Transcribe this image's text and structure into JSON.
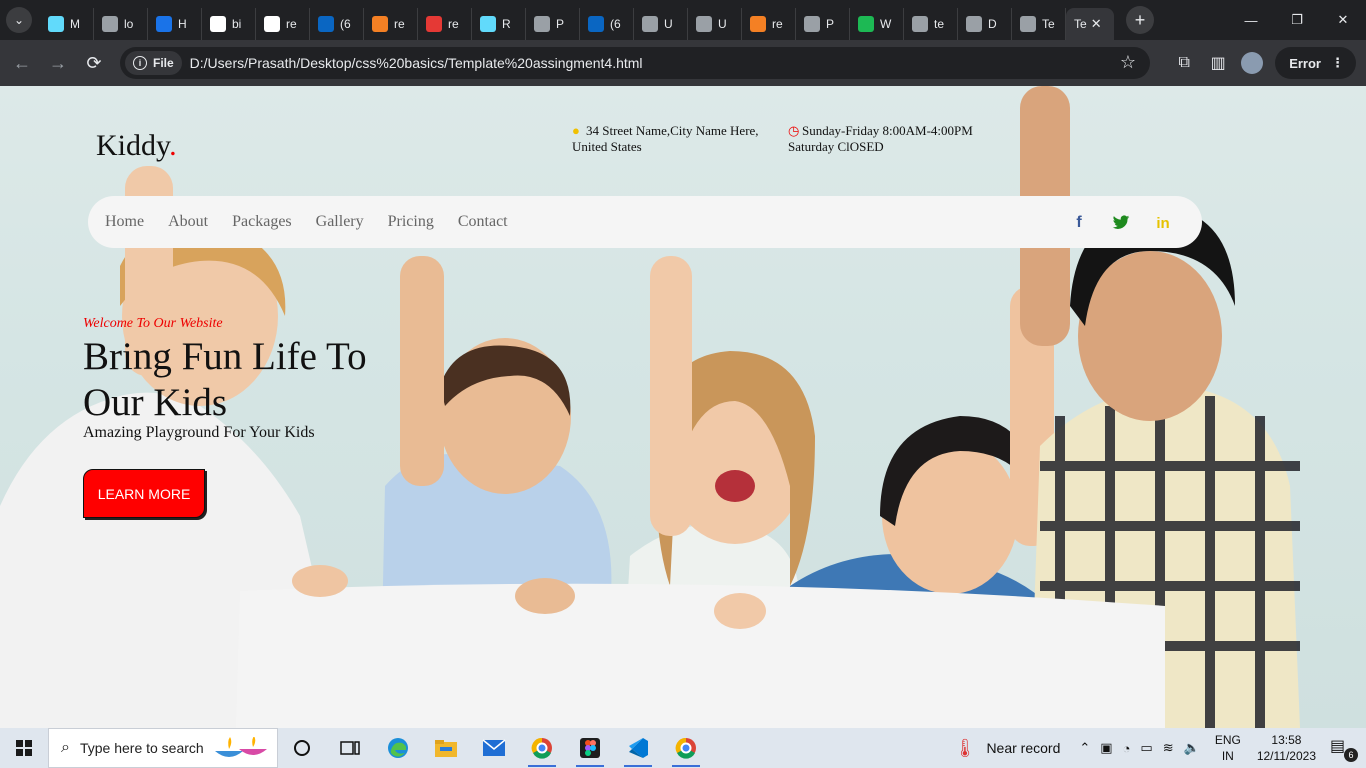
{
  "browser": {
    "tabs": [
      {
        "label": "M",
        "icon": "react-icon",
        "color": "#61dafb"
      },
      {
        "label": "lo",
        "icon": "gear-icon",
        "color": "#9aa0a6"
      },
      {
        "label": "H",
        "icon": "hackerrank-icon",
        "color": "#1a73e8"
      },
      {
        "label": "bi",
        "icon": "google-icon",
        "color": "#ffffff"
      },
      {
        "label": "re",
        "icon": "google-icon",
        "color": "#ffffff"
      },
      {
        "label": "(6",
        "icon": "linkedin-icon",
        "color": "#0a66c2"
      },
      {
        "label": "re",
        "icon": "stackoverflow-icon",
        "color": "#f48024"
      },
      {
        "label": "re",
        "icon": "n-icon",
        "color": "#e53935"
      },
      {
        "label": "R",
        "icon": "react-icon",
        "color": "#61dafb"
      },
      {
        "label": "P",
        "icon": "github-icon",
        "color": "#9aa0a6"
      },
      {
        "label": "(6",
        "icon": "linkedin-icon",
        "color": "#0a66c2"
      },
      {
        "label": "U",
        "icon": "globe-icon",
        "color": "#9aa0a6"
      },
      {
        "label": "U",
        "icon": "globe-icon",
        "color": "#9aa0a6"
      },
      {
        "label": "re",
        "icon": "stackoverflow-icon",
        "color": "#f48024"
      },
      {
        "label": "P",
        "icon": "github-icon",
        "color": "#9aa0a6"
      },
      {
        "label": "W",
        "icon": "w-icon",
        "color": "#1db954"
      },
      {
        "label": "te",
        "icon": "globe-icon",
        "color": "#9aa0a6"
      },
      {
        "label": "D",
        "icon": "globe-icon",
        "color": "#9aa0a6"
      },
      {
        "label": "Te",
        "icon": "globe-icon",
        "color": "#9aa0a6"
      }
    ],
    "active_tab": {
      "label": "Te"
    },
    "url_chip": "File",
    "url": "D:/Users/Prasath/Desktop/css%20basics/Template%20assingment4.html",
    "profile_button": "Error"
  },
  "page": {
    "logo": "Kiddy",
    "logo_dot": ".",
    "address_line1": "34 Street Name,City Name Here,",
    "address_line2": "United States",
    "hours_line1": "Sunday-Friday 8:00AM-4:00PM",
    "hours_line2": "Saturday ClOSED",
    "nav": [
      "Home",
      "About",
      "Packages",
      "Gallery",
      "Pricing",
      "Contact"
    ],
    "social": {
      "facebook": "f",
      "twitter": "🐦",
      "linkedin": "in"
    },
    "welcome": "Welcome To Our Website",
    "headline": "Bring Fun Life To Our Kids",
    "subheadline": "Amazing Playground For Your Kids",
    "cta": "LEARN MORE",
    "accent_color": "#ff0000"
  },
  "taskbar": {
    "search_placeholder": "Type here to search",
    "weather": "Near record",
    "lang_line1": "ENG",
    "lang_line2": "IN",
    "time": "13:58",
    "date": "12/11/2023",
    "notifications": "6"
  }
}
